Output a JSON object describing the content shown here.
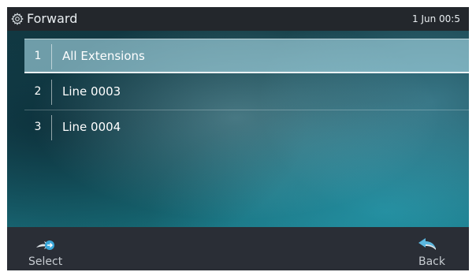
{
  "header": {
    "title": "Forward",
    "time": "1 Jun 00:5",
    "icon": "gear-icon"
  },
  "menu": {
    "items": [
      {
        "number": "1",
        "label": "All Extensions",
        "selected": true
      },
      {
        "number": "2",
        "label": "Line  0003",
        "selected": false
      },
      {
        "number": "3",
        "label": "Line  0004",
        "selected": false
      }
    ]
  },
  "softkeys": {
    "select": {
      "label": "Select",
      "icon": "select-arrow-icon"
    },
    "back": {
      "label": "Back",
      "icon": "back-arrow-icon"
    }
  },
  "colors": {
    "title_bar": "#23272c",
    "softkey_bar": "#2a2e36",
    "highlight": "#aadce8",
    "accent_icon": "#3aa6d8"
  }
}
